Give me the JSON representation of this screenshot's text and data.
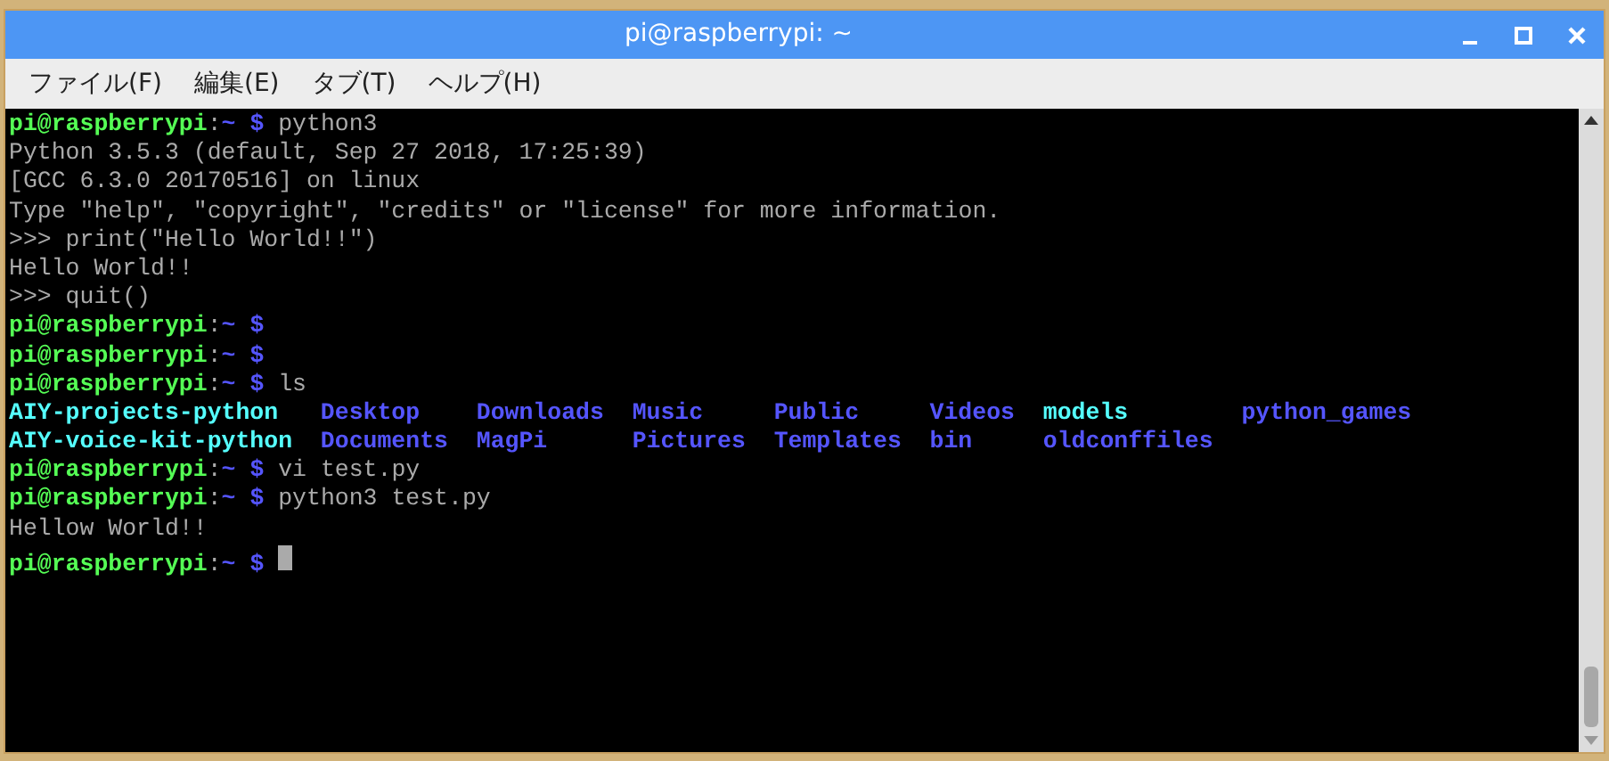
{
  "window": {
    "title": "pi@raspberrypi: ~"
  },
  "menu": [
    {
      "label": "ファイル(F)"
    },
    {
      "label": "編集(E)"
    },
    {
      "label": "タブ(T)"
    },
    {
      "label": "ヘルプ(H)"
    }
  ],
  "terminal": {
    "lines": [
      {
        "kind": "prompt",
        "host": "pi@raspberrypi",
        "separator": ":",
        "path": "~",
        "symbol": "$",
        "command": "python3"
      },
      {
        "kind": "output",
        "text": "Python 3.5.3 (default, Sep 27 2018, 17:25:39)"
      },
      {
        "kind": "output",
        "text": "[GCC 6.3.0 20170516] on linux"
      },
      {
        "kind": "output",
        "text": "Type \"help\", \"copyright\", \"credits\" or \"license\" for more information."
      },
      {
        "kind": "output",
        "text": ">>> print(\"Hello World!!\")"
      },
      {
        "kind": "output",
        "text": "Hello World!!"
      },
      {
        "kind": "output",
        "text": ">>> quit()"
      },
      {
        "kind": "prompt",
        "host": "pi@raspberrypi",
        "separator": ":",
        "path": "~",
        "symbol": "$"
      },
      {
        "kind": "prompt",
        "host": "pi@raspberrypi",
        "separator": ":",
        "path": "~",
        "symbol": "$"
      },
      {
        "kind": "prompt",
        "host": "pi@raspberrypi",
        "separator": ":",
        "path": "~",
        "symbol": "$",
        "command": "ls"
      },
      {
        "kind": "listing",
        "entries": [
          {
            "name": "AIY-projects-python",
            "color": "#55ffff"
          },
          {
            "name": "Desktop",
            "color": "#5555ff"
          },
          {
            "name": "Downloads",
            "color": "#5555ff"
          },
          {
            "name": "Music",
            "color": "#5555ff"
          },
          {
            "name": "Public",
            "color": "#5555ff"
          },
          {
            "name": "Videos",
            "color": "#5555ff"
          },
          {
            "name": "models",
            "color": "#55ffff"
          },
          {
            "name": "python_games",
            "color": "#5555ff"
          }
        ]
      },
      {
        "kind": "listing",
        "entries": [
          {
            "name": "AIY-voice-kit-python",
            "color": "#55ffff"
          },
          {
            "name": "Documents",
            "color": "#5555ff"
          },
          {
            "name": "MagPi",
            "color": "#5555ff"
          },
          {
            "name": "Pictures",
            "color": "#5555ff"
          },
          {
            "name": "Templates",
            "color": "#5555ff"
          },
          {
            "name": "bin",
            "color": "#5555ff"
          },
          {
            "name": "oldconffiles",
            "color": "#5555ff"
          }
        ]
      },
      {
        "kind": "prompt",
        "host": "pi@raspberrypi",
        "separator": ":",
        "path": "~",
        "symbol": "$",
        "command": "vi test.py"
      },
      {
        "kind": "prompt",
        "host": "pi@raspberrypi",
        "separator": ":",
        "path": "~",
        "symbol": "$",
        "command": "python3 test.py"
      },
      {
        "kind": "output",
        "text": "Hellow World!!"
      },
      {
        "kind": "prompt",
        "host": "pi@raspberrypi",
        "separator": ":",
        "path": "~",
        "symbol": "$",
        "cursor": true
      }
    ]
  }
}
